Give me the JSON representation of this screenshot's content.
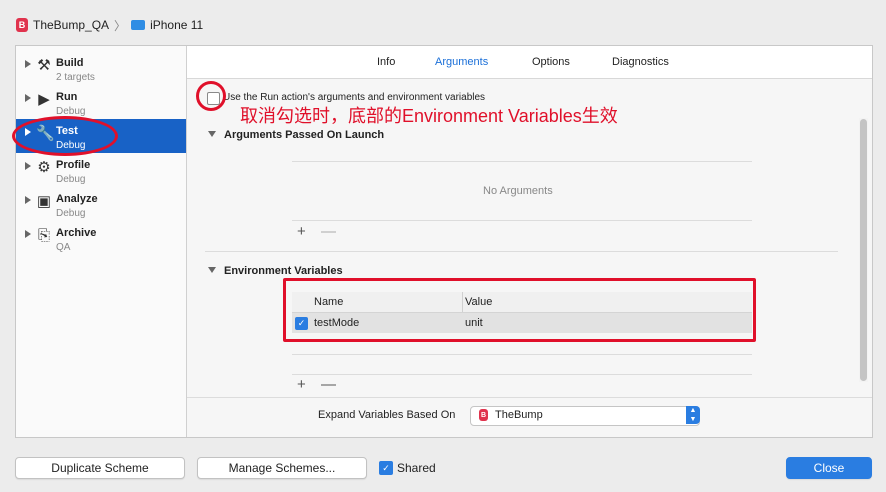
{
  "breadcrumb": {
    "app_icon_letter": "B",
    "scheme": "TheBump_QA",
    "destination": "iPhone 11"
  },
  "sidebar": {
    "items": [
      {
        "name": "Build",
        "sub": "2 targets",
        "icon": "hammer-icon",
        "glyph": "⚒"
      },
      {
        "name": "Run",
        "sub": "Debug",
        "icon": "play-icon",
        "glyph": "▶"
      },
      {
        "name": "Test",
        "sub": "Debug",
        "icon": "wrench-icon",
        "glyph": "🔧",
        "selected": true
      },
      {
        "name": "Profile",
        "sub": "Debug",
        "icon": "profile-icon",
        "glyph": "⚙"
      },
      {
        "name": "Analyze",
        "sub": "Debug",
        "icon": "analyze-icon",
        "glyph": "▣"
      },
      {
        "name": "Archive",
        "sub": "QA",
        "icon": "archive-icon",
        "glyph": "⎘"
      }
    ]
  },
  "tabs": [
    "Info",
    "Arguments",
    "Options",
    "Diagnostics"
  ],
  "active_tab": "Arguments",
  "use_run_action": {
    "label": "Use the Run action's arguments and environment variables",
    "checked": false
  },
  "annotation": "取消勾选时，底部的Environment Variables生效",
  "arguments_section": {
    "title": "Arguments Passed On Launch",
    "empty_text": "No Arguments",
    "add": "+",
    "remove": "—"
  },
  "env_section": {
    "title": "Environment Variables",
    "columns": [
      "Name",
      "Value"
    ],
    "rows": [
      {
        "checked": true,
        "name": "testMode",
        "value": "unit"
      }
    ],
    "add": "+",
    "remove": "—"
  },
  "expand_vars": {
    "label": "Expand Variables Based On",
    "value": "TheBump",
    "icon_letter": "B"
  },
  "footer": {
    "duplicate": "Duplicate Scheme",
    "manage": "Manage Schemes...",
    "shared_label": "Shared",
    "shared_checked": true,
    "close": "Close"
  },
  "colors": {
    "accent": "#2a7de1",
    "selection": "#1862c6",
    "annotation": "#e0102a"
  }
}
